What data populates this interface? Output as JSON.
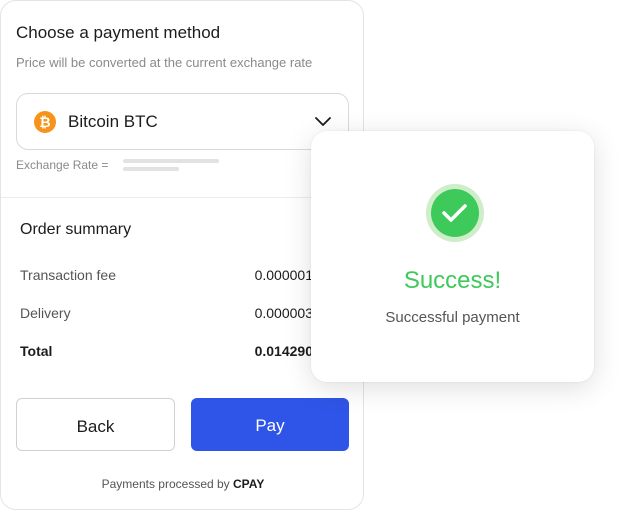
{
  "payment": {
    "title": "Choose a payment method",
    "subtitle": "Price will be converted at the current exchange rate",
    "currency": {
      "label": "Bitcoin BTC",
      "icon": "bitcoin-icon",
      "icon_symbol": "₿",
      "icon_color": "#f7931a"
    },
    "exchange_rate_label": "Exchange Rate =",
    "order_summary": {
      "title": "Order summary",
      "rows": [
        {
          "label": "Transaction fee",
          "value": "0.000001"
        },
        {
          "label": "Delivery",
          "value": "0.000003"
        },
        {
          "label": "Total",
          "value": "0.014290"
        }
      ]
    },
    "buttons": {
      "back": "Back",
      "pay": "Pay"
    },
    "footer": {
      "prefix": "Payments processed by",
      "brand": "CPAY"
    }
  },
  "success": {
    "title": "Success!",
    "subtitle": "Successful payment",
    "icon": "check-icon"
  },
  "colors": {
    "accent": "#2f55e8",
    "success": "#3ec95b",
    "bitcoin": "#f7931a"
  }
}
